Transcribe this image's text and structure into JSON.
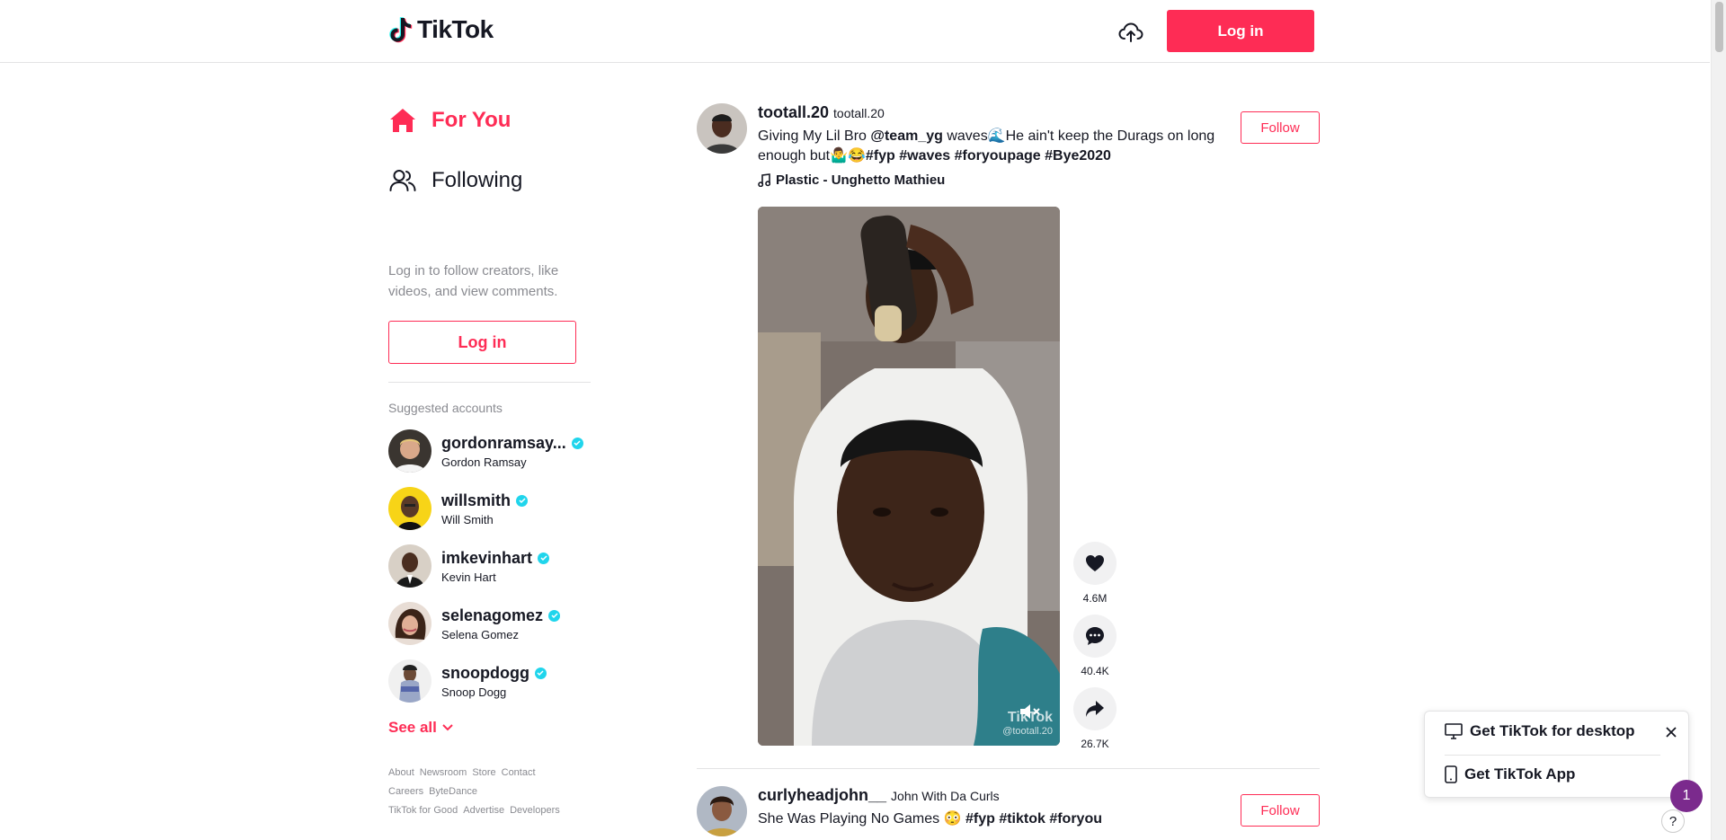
{
  "header": {
    "logo_text": "TikTok",
    "login_label": "Log in"
  },
  "sidebar": {
    "nav": [
      {
        "label": "For You",
        "active": true
      },
      {
        "label": "Following",
        "active": false
      }
    ],
    "login_tip": "Log in to follow creators, like videos, and view comments.",
    "login_label": "Log in",
    "suggested_title": "Suggested accounts",
    "accounts": [
      {
        "username": "gordonramsay...",
        "name": "Gordon Ramsay",
        "verified": true
      },
      {
        "username": "willsmith",
        "name": "Will Smith",
        "verified": true
      },
      {
        "username": "imkevinhart",
        "name": "Kevin Hart",
        "verified": true
      },
      {
        "username": "selenagomez",
        "name": "Selena Gomez",
        "verified": true
      },
      {
        "username": "snoopdogg",
        "name": "Snoop Dogg",
        "verified": true
      }
    ],
    "see_all": "See all",
    "footer_row1": [
      "About",
      "Newsroom",
      "Store",
      "Contact"
    ],
    "footer_row2": [
      "Careers",
      "ByteDance"
    ],
    "footer_row3": [
      "TikTok for Good",
      "Advertise",
      "Developers"
    ]
  },
  "posts": [
    {
      "author_id": "tootall.20",
      "author_nick": "tootall.20",
      "caption_prefix": "Giving My Lil Bro ",
      "caption_mention": "@team_yg",
      "caption_mid": " waves🌊He ain't keep the Durags on long enough but🤷‍♂️😂",
      "caption_tags": "#fyp #waves #foryoupage #Bye2020",
      "music": "Plastic - Unghetto Mathieu",
      "follow_label": "Follow",
      "watermark_brand": "TikTok",
      "watermark_handle": "@tootall.20",
      "likes": "4.6M",
      "comments": "40.4K",
      "shares": "26.7K"
    },
    {
      "author_id": "curlyheadjohn__",
      "author_nick": "John With Da Curls",
      "caption_prefix": "She Was Playing No Games 😳 ",
      "caption_tags": "#fyp #tiktok #foryou",
      "follow_label": "Follow"
    }
  ],
  "get_app": {
    "desktop_label": "Get TikTok for desktop",
    "app_label": "Get TikTok App",
    "badge_count": "1",
    "help_label": "?"
  },
  "colors": {
    "brand": "#fe2c55",
    "verified": "#20d5ec",
    "text": "#161823",
    "muted": "#8a8b91"
  }
}
